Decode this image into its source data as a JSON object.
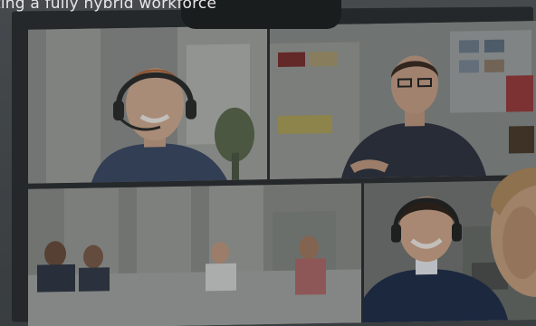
{
  "caption": {
    "text": "ting a fully hybrid workforce"
  },
  "colors": {
    "wall": "#4a4e52",
    "bezel": "#2a2d30",
    "navy_sweater": "#1f2e4a",
    "shirt_dark": "#2b3240"
  },
  "tiles": [
    {
      "id": "tile-1",
      "subject": "woman with headset"
    },
    {
      "id": "tile-2",
      "subject": "man in dark shirt"
    },
    {
      "id": "tile-3",
      "subject": "meeting room group"
    },
    {
      "id": "tile-4",
      "subject": "man with headset in navy sweater"
    }
  ]
}
